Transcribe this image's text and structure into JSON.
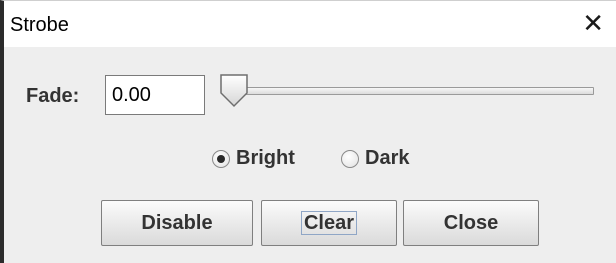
{
  "window": {
    "title": "Strobe",
    "close_glyph": "✕"
  },
  "fade": {
    "label": "Fade:",
    "value": "0.00",
    "slider_value": 0
  },
  "mode": {
    "options": [
      {
        "label": "Bright",
        "selected": true
      },
      {
        "label": "Dark",
        "selected": false
      }
    ]
  },
  "buttons": {
    "disable_label": "Disable",
    "clear_label": "Clear",
    "close_label": "Close"
  }
}
